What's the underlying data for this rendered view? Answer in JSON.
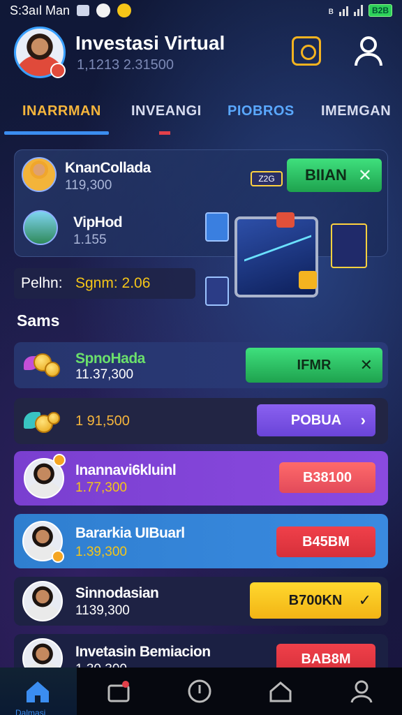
{
  "status": {
    "time": "S:3aıl Man",
    "battery": "B2B"
  },
  "header": {
    "title": "Investasi Virtual",
    "subtitle": "1,1213 2.31500",
    "icons": [
      "wallet-icon",
      "user-icon"
    ]
  },
  "tabs": [
    "INARRMAN",
    "INVEANGI",
    "PIOBROS",
    "IMEMGAN"
  ],
  "hero": {
    "user1": {
      "name": "KnanCollada",
      "value": "119,300"
    },
    "user2": {
      "name": "VipHod",
      "value": "1.155"
    },
    "button": "BIIAN",
    "chip": "Z2G"
  },
  "pellan": {
    "label": "Pelhn:",
    "value": "Sgnm: 2.06"
  },
  "section": "Sams",
  "rows": [
    {
      "name": "SpnoHada",
      "value": "11.37,300",
      "button": "IFMR",
      "icon": "check-icon"
    },
    {
      "name": "",
      "value": "1 91,500",
      "button": "POBUA",
      "icon": "chevron-right-icon"
    },
    {
      "name": "Inannavi6kluinl",
      "value": "1.77,300",
      "button": "B38100"
    },
    {
      "name": "Bararkia UIBuarl",
      "value": "1.39,300",
      "button": "B45BM"
    },
    {
      "name": "Sinnodasian",
      "value": "1139,300",
      "button": "B700KN",
      "icon": "check-icon"
    },
    {
      "name": "Invetasin Bemiacion",
      "value": "1.30,300",
      "button": "BAB8M"
    }
  ],
  "nav": [
    {
      "label": "Dalmasi",
      "icon": "home-icon"
    },
    {
      "label": "",
      "icon": "briefcase-icon"
    },
    {
      "label": "",
      "icon": "alert-icon"
    },
    {
      "label": "",
      "icon": "house-icon"
    },
    {
      "label": "",
      "icon": "profile-icon"
    }
  ],
  "colors": {
    "accent": "#3b8df0",
    "green": "#2fd16a",
    "purple": "#7b4fe0",
    "red": "#e6404a",
    "yellow": "#f5c518"
  }
}
